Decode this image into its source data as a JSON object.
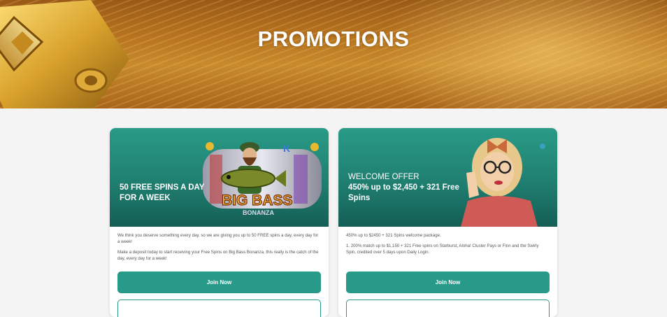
{
  "hero": {
    "title": "PROMOTIONS"
  },
  "promotions": [
    {
      "heading_lines": [
        "50 FREE SPINS A DAY",
        "FOR A WEEK"
      ],
      "art_text": [
        "BIG BASS",
        "BONANZA"
      ],
      "paragraphs": [
        "We think you deserve something every day, so we are giving you up to 50 FREE spins a day, every day for a week!",
        "Make a deposit today to start receiving your Free Spins on Big Bass Bonanza, this really is the catch of the day, every day for a week!"
      ],
      "button_label": "Join Now"
    },
    {
      "heading_lines": [
        "WELCOME OFFER",
        "450% up to $2,450 + 321 Free Spins"
      ],
      "paragraphs": [
        "450% up to $2450 + 321 Spins welcome package.",
        "1. 200% match up to $1,150 + 321 Free spins on Starburst, Aloha! Cluster Pays or Finn and the Swirly Spin, credited over 5 days upon Daily Login."
      ],
      "button_label": "Join Now"
    }
  ],
  "colors": {
    "accent": "#279a89",
    "card_header": "#1f7f70",
    "hero_gold": "#b8741f",
    "page_bg": "#f4f4f4"
  }
}
